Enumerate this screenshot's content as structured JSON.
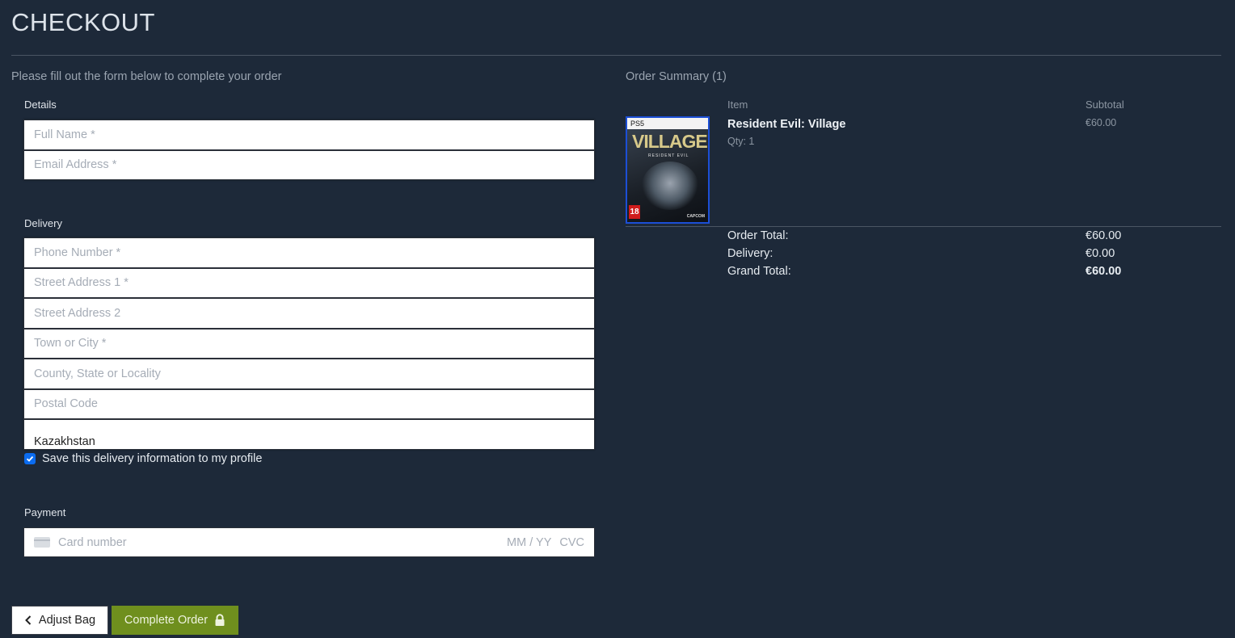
{
  "page": {
    "title": "CHECKOUT",
    "lead": "Please fill out the form below to complete your order"
  },
  "details": {
    "label": "Details",
    "fields": [
      {
        "placeholder": "Full Name *",
        "value": ""
      },
      {
        "placeholder": "Email Address *",
        "value": ""
      }
    ]
  },
  "delivery": {
    "label": "Delivery",
    "fields": [
      {
        "placeholder": "Phone Number *",
        "value": ""
      },
      {
        "placeholder": "Street Address 1 *",
        "value": ""
      },
      {
        "placeholder": "Street Address 2",
        "value": ""
      },
      {
        "placeholder": "Town or City *",
        "value": ""
      },
      {
        "placeholder": "County, State or Locality",
        "value": ""
      },
      {
        "placeholder": "Postal Code",
        "value": ""
      }
    ],
    "country": "Kazakhstan",
    "save_label": "Save this delivery information to my profile",
    "save_checked": true
  },
  "payment": {
    "label": "Payment",
    "card_placeholder": "Card number",
    "expiry_placeholder": "MM / YY",
    "cvc_placeholder": "CVC",
    "card_icon": "credit-card-icon"
  },
  "buttons": {
    "adjust_label": "Adjust Bag",
    "adjust_icon": "chevron-left-icon",
    "complete_label": "Complete Order",
    "complete_icon": "lock-icon",
    "complete_color": "#6f8f1e"
  },
  "summary": {
    "title": "Order Summary (1)",
    "item_header": "Item",
    "subtotal_header": "Subtotal",
    "item": {
      "name": "Resident Evil: Village",
      "qty": "Qty: 1",
      "subtotal": "€60.00",
      "cover_platform": "PS5",
      "cover_title": "VILLAGE",
      "cover_subtitle": "RESIDENT EVIL",
      "cover_rating": "18",
      "cover_publisher": "CAPCOM"
    },
    "order_total_label": "Order Total:",
    "order_total": "€60.00",
    "delivery_label": "Delivery:",
    "delivery_value": "€0.00",
    "grand_total_label": "Grand Total:",
    "grand_total": "€60.00"
  }
}
